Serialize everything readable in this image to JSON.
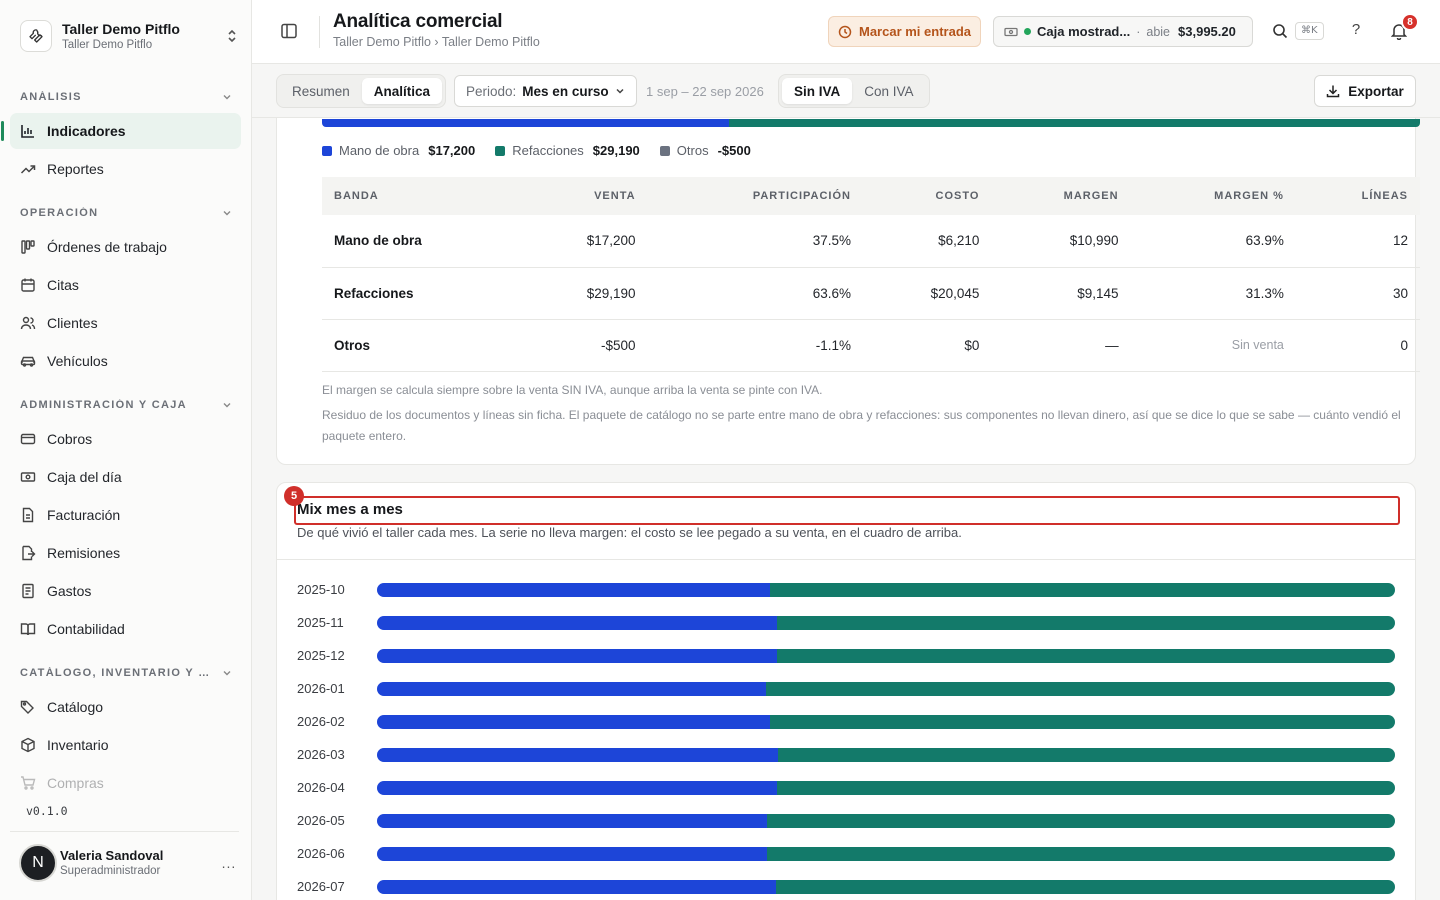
{
  "workspace": {
    "name": "Taller Demo Pitflo",
    "sub": "Taller Demo Pitflo"
  },
  "sidebar": {
    "sections": [
      {
        "label": "ANÁLISIS",
        "items": [
          {
            "label": "Indicadores",
            "icon": "bar-chart-icon",
            "active": true
          },
          {
            "label": "Reportes",
            "icon": "trend-up-icon"
          }
        ]
      },
      {
        "label": "OPERACIÓN",
        "items": [
          {
            "label": "Órdenes de trabajo",
            "icon": "kanban-icon"
          },
          {
            "label": "Citas",
            "icon": "calendar-icon"
          },
          {
            "label": "Clientes",
            "icon": "users-icon"
          },
          {
            "label": "Vehículos",
            "icon": "car-icon"
          }
        ]
      },
      {
        "label": "ADMINISTRACIÓN Y CAJA",
        "items": [
          {
            "label": "Cobros",
            "icon": "credit-card-icon"
          },
          {
            "label": "Caja del día",
            "icon": "cash-icon"
          },
          {
            "label": "Facturación",
            "icon": "document-icon"
          },
          {
            "label": "Remisiones",
            "icon": "file-export-icon"
          },
          {
            "label": "Gastos",
            "icon": "receipt-icon"
          },
          {
            "label": "Contabilidad",
            "icon": "book-icon"
          }
        ]
      },
      {
        "label": "CATÁLOGO, INVENTARIO Y CO...",
        "items": [
          {
            "label": "Catálogo",
            "icon": "tags-icon"
          },
          {
            "label": "Inventario",
            "icon": "box-icon"
          },
          {
            "label": "Compras",
            "icon": "cart-icon"
          }
        ]
      }
    ],
    "version": "v0.1.0",
    "user": {
      "initial": "N",
      "name": "Valeria Sandoval",
      "role": "Superadministrador",
      "more": "..."
    }
  },
  "header": {
    "title": "Analítica comercial",
    "breadcrumb": "Taller Demo Pitflo › Taller Demo Pitflo",
    "mark_entry": "Marcar mi entrada",
    "caja": {
      "name": "Caja mostrad...",
      "sep": "·",
      "status": "abie",
      "amount": "$3,995.20"
    },
    "shortcut": "⌘K",
    "help": "?",
    "notifications": "8"
  },
  "toolbar": {
    "tabs": [
      "Resumen",
      "Analítica"
    ],
    "active_tab": "Analítica",
    "period_label": "Periodo:",
    "period_value": "Mes en curso",
    "range": "1 sep – 22 sep 2026",
    "tax_options": [
      "Sin IVA",
      "Con IVA"
    ],
    "active_tax": "Sin IVA",
    "export": "Exportar"
  },
  "bands": {
    "legend": [
      {
        "name": "Mano de obra",
        "value": "$17,200",
        "color": "#1d45d8"
      },
      {
        "name": "Refacciones",
        "value": "$29,190",
        "color": "#137a6a"
      },
      {
        "name": "Otros",
        "value": "-$500",
        "color": "#6b7280"
      }
    ],
    "stack_share": {
      "mano_de_obra": 0.371,
      "refacciones": 0.629
    },
    "columns": [
      "BANDA",
      "VENTA",
      "PARTICIPACIÓN",
      "COSTO",
      "MARGEN",
      "MARGEN %",
      "LÍNEAS"
    ],
    "rows": [
      [
        "Mano de obra",
        "$17,200",
        "37.5%",
        "$6,210",
        "$10,990",
        "63.9%",
        "12"
      ],
      [
        "Refacciones",
        "$29,190",
        "63.6%",
        "$20,045",
        "$9,145",
        "31.3%",
        "30"
      ],
      [
        "Otros",
        "-$500",
        "-1.1%",
        "$0",
        "—",
        "Sin venta",
        "0"
      ]
    ],
    "note1": "El margen se calcula siempre sobre la venta SIN IVA, aunque arriba la venta se pinte con IVA.",
    "note2": "Residuo de los documentos y líneas sin ficha. El paquete de catálogo no se parte entre mano de obra y refacciones: sus componentes no llevan dinero, así que se dice lo que se sabe — cuánto vendió el paquete entero."
  },
  "mix": {
    "badge": "5",
    "title": "Mix mes a mes",
    "subtitle": "De qué vivió el taller cada mes. La serie no lleva margen: el costo se lee pegado a su venta, en el cuadro de arriba.",
    "months": [
      {
        "label": "2025-10",
        "mano_de_obra_share": 0.386
      },
      {
        "label": "2025-11",
        "mano_de_obra_share": 0.393
      },
      {
        "label": "2025-12",
        "mano_de_obra_share": 0.393
      },
      {
        "label": "2026-01",
        "mano_de_obra_share": 0.382
      },
      {
        "label": "2026-02",
        "mano_de_obra_share": 0.386
      },
      {
        "label": "2026-03",
        "mano_de_obra_share": 0.394
      },
      {
        "label": "2026-04",
        "mano_de_obra_share": 0.393
      },
      {
        "label": "2026-05",
        "mano_de_obra_share": 0.383
      },
      {
        "label": "2026-06",
        "mano_de_obra_share": 0.383
      },
      {
        "label": "2026-07",
        "mano_de_obra_share": 0.392
      }
    ]
  }
}
